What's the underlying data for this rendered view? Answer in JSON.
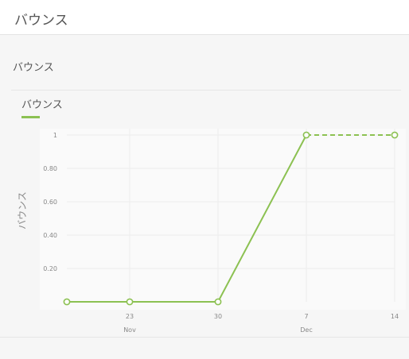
{
  "header": {
    "title": "バウンス"
  },
  "panel": {
    "title": "バウンス"
  },
  "chart_data": {
    "type": "line",
    "title": "",
    "ylabel": "バウンス",
    "xlabel": "",
    "ylim": [
      0,
      1
    ],
    "y_ticks": [
      "0.20",
      "0.40",
      "0.60",
      "0.80",
      "1"
    ],
    "x_ticks": [
      {
        "day": "23",
        "month": "Nov"
      },
      {
        "day": "30",
        "month": ""
      },
      {
        "day": "7",
        "month": "Dec"
      },
      {
        "day": "14",
        "month": ""
      }
    ],
    "series": [
      {
        "name": "バウンス",
        "color": "#8cc152",
        "x": [
          "2023-11-16",
          "2023-11-23",
          "2023-11-30",
          "2023-12-07",
          "2023-12-14"
        ],
        "values": [
          0,
          0,
          0,
          1,
          1
        ],
        "dashed_from_index": 3
      }
    ],
    "legend_position": "top-left",
    "grid": true
  }
}
